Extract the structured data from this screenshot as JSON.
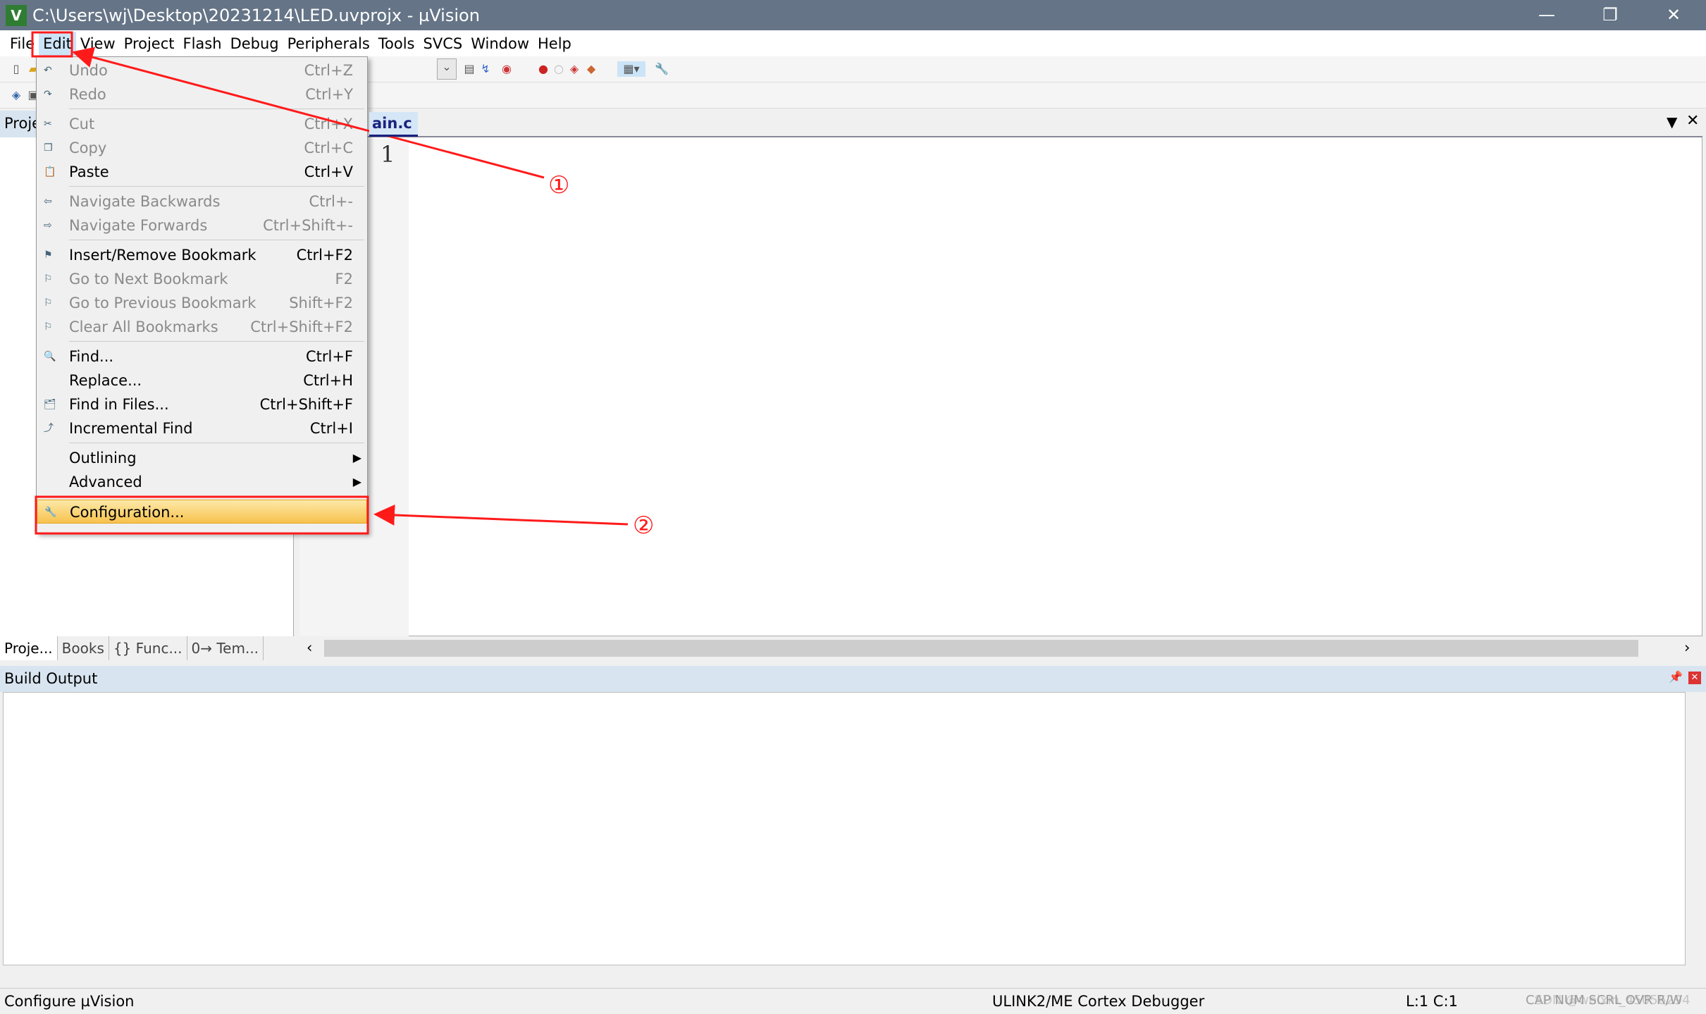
{
  "window": {
    "title": "C:\\Users\\wj\\Desktop\\20231214\\LED.uvprojx - µVision",
    "icon": "V",
    "minimize": "—",
    "restore": "❐",
    "close": "✕"
  },
  "menubar": [
    "File",
    "Edit",
    "View",
    "Project",
    "Flash",
    "Debug",
    "Peripherals",
    "Tools",
    "SVCS",
    "Window",
    "Help"
  ],
  "left_panel": {
    "header": "Proje",
    "tabs": [
      "Proje...",
      "Books",
      "{} Func...",
      "0→ Tem..."
    ]
  },
  "editor": {
    "file_tab": "ain.c",
    "line_number": "1"
  },
  "edit_menu": {
    "items": [
      {
        "label": "Undo",
        "shortcut": "Ctrl+Z",
        "disabled": true,
        "icon": "undo-icon"
      },
      {
        "label": "Redo",
        "shortcut": "Ctrl+Y",
        "disabled": true,
        "icon": "redo-icon"
      },
      {
        "sep": true
      },
      {
        "label": "Cut",
        "shortcut": "Ctrl+X",
        "disabled": true,
        "icon": "cut-icon"
      },
      {
        "label": "Copy",
        "shortcut": "Ctrl+C",
        "disabled": true,
        "icon": "copy-icon"
      },
      {
        "label": "Paste",
        "shortcut": "Ctrl+V",
        "disabled": false,
        "icon": "paste-icon"
      },
      {
        "sep": true
      },
      {
        "label": "Navigate Backwards",
        "shortcut": "Ctrl+-",
        "disabled": true,
        "icon": "back-icon"
      },
      {
        "label": "Navigate Forwards",
        "shortcut": "Ctrl+Shift+-",
        "disabled": true,
        "icon": "forward-icon"
      },
      {
        "sep": true
      },
      {
        "label": "Insert/Remove Bookmark",
        "shortcut": "Ctrl+F2",
        "disabled": false,
        "icon": "bookmark-icon"
      },
      {
        "label": "Go to Next Bookmark",
        "shortcut": "F2",
        "disabled": true,
        "icon": "next-bookmark-icon"
      },
      {
        "label": "Go to Previous Bookmark",
        "shortcut": "Shift+F2",
        "disabled": true,
        "icon": "prev-bookmark-icon"
      },
      {
        "label": "Clear All Bookmarks",
        "shortcut": "Ctrl+Shift+F2",
        "disabled": true,
        "icon": "clear-bookmarks-icon"
      },
      {
        "sep": true
      },
      {
        "label": "Find...",
        "shortcut": "Ctrl+F",
        "disabled": false,
        "icon": "find-icon"
      },
      {
        "label": "Replace...",
        "shortcut": "Ctrl+H",
        "disabled": false,
        "icon": ""
      },
      {
        "label": "Find in Files...",
        "shortcut": "Ctrl+Shift+F",
        "disabled": false,
        "icon": "find-in-files-icon"
      },
      {
        "label": "Incremental Find",
        "shortcut": "Ctrl+I",
        "disabled": false,
        "icon": "incremental-find-icon"
      },
      {
        "sep": true
      },
      {
        "label": "Outlining",
        "shortcut": "",
        "disabled": false,
        "submenu": true
      },
      {
        "label": "Advanced",
        "shortcut": "",
        "disabled": false,
        "submenu": true
      },
      {
        "sep": true
      },
      {
        "label": "Configuration...",
        "shortcut": "",
        "disabled": false,
        "highlighted": true,
        "icon": "wrench-icon"
      }
    ]
  },
  "build_output": {
    "title": "Build Output"
  },
  "statusbar": {
    "message": "Configure µVision",
    "debugger": "ULINK2/ME Cortex Debugger",
    "position": "L:1 C:1",
    "indicators": "CAP NUM SCRL OVR R/W",
    "watermark": "CSDN @weixin_45056294"
  },
  "annotations": {
    "marker1": "①",
    "marker2": "②",
    "color": "#ff1a1a"
  }
}
